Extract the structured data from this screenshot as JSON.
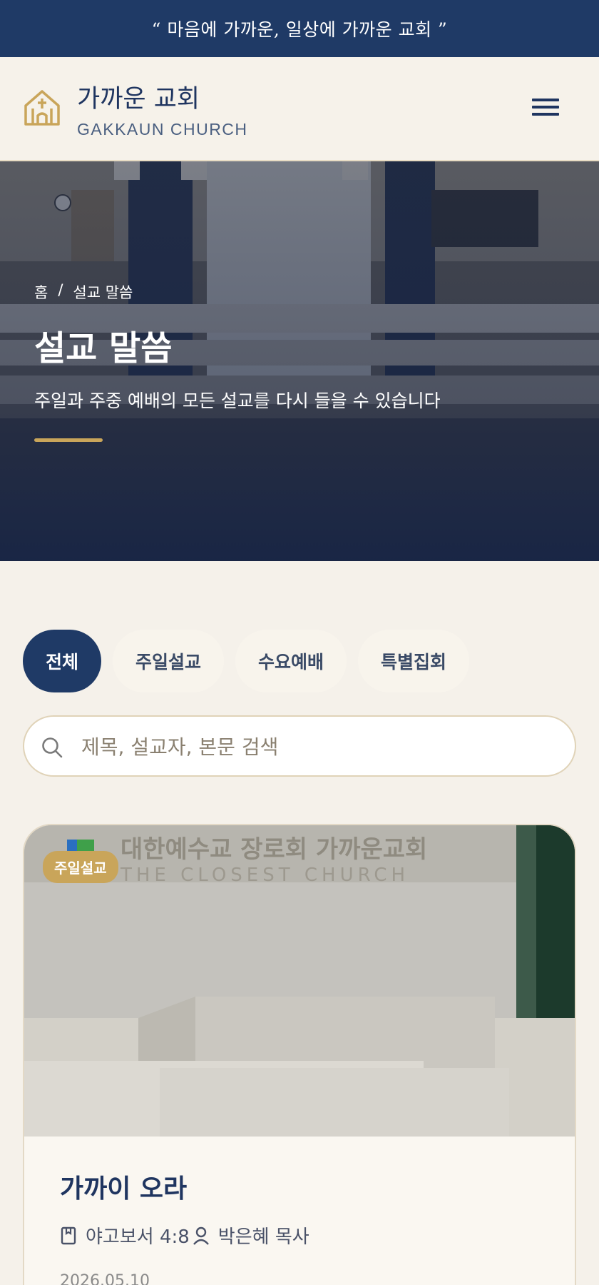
{
  "topbar": {
    "quote": "“ 마음에 가까운, 일상에 가까운 교회 ”"
  },
  "brand": {
    "name": "가까운 교회",
    "subtitle": "GAKKAUN CHURCH",
    "icon": "church-icon"
  },
  "nav": {
    "menu_icon": "hamburger-icon"
  },
  "hero": {
    "breadcrumb": {
      "home": "홈",
      "separator": "/",
      "current": "설교 말씀"
    },
    "title": "설교 말씀",
    "description": "주일과 주중 예배의 모든 설교를 다시 들을 수 있습니다"
  },
  "filters": [
    {
      "label": "전체",
      "active": true
    },
    {
      "label": "주일설교",
      "active": false
    },
    {
      "label": "수요예배",
      "active": false
    },
    {
      "label": "특별집회",
      "active": false
    }
  ],
  "search": {
    "placeholder": "제목, 설교자, 본문 검색",
    "icon": "search-icon"
  },
  "sermons": [
    {
      "badge": "주일설교",
      "title": "가까이 오라",
      "scripture": "야고보서 4:8",
      "preacher": "박은혜 목사",
      "date": "2026.05.10",
      "image_sign_ko": "대한예수교 장로회 가까운교회",
      "image_sign_en": "THE CLOSEST CHURCH"
    }
  ],
  "colors": {
    "navy": "#1f3a66",
    "gold": "#c9a55a",
    "background": "#f5f1ea"
  }
}
